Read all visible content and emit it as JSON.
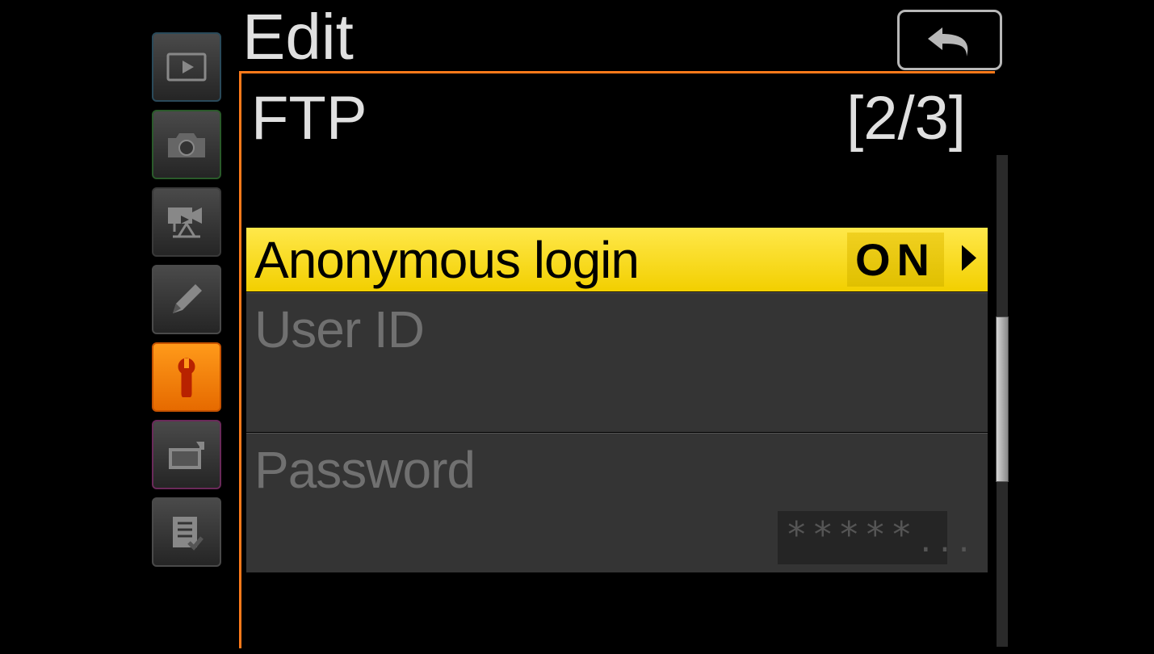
{
  "header": {
    "title": "Edit",
    "section": "FTP",
    "page_indicator": "[2/3]"
  },
  "sidebar": {
    "items": [
      {
        "icon": "playback"
      },
      {
        "icon": "camera"
      },
      {
        "icon": "video"
      },
      {
        "icon": "pencil"
      },
      {
        "icon": "wrench",
        "active": true
      },
      {
        "icon": "retouch"
      },
      {
        "icon": "mymenu"
      }
    ]
  },
  "menu": {
    "items": [
      {
        "label": "Anonymous login",
        "value": "ON",
        "selected": true
      },
      {
        "label": "User ID",
        "value": "",
        "disabled": true
      },
      {
        "label": "Password",
        "value": "*****",
        "disabled": true
      }
    ]
  },
  "icons": {
    "back": "back-arrow",
    "chevron_right": "chevron-right"
  }
}
